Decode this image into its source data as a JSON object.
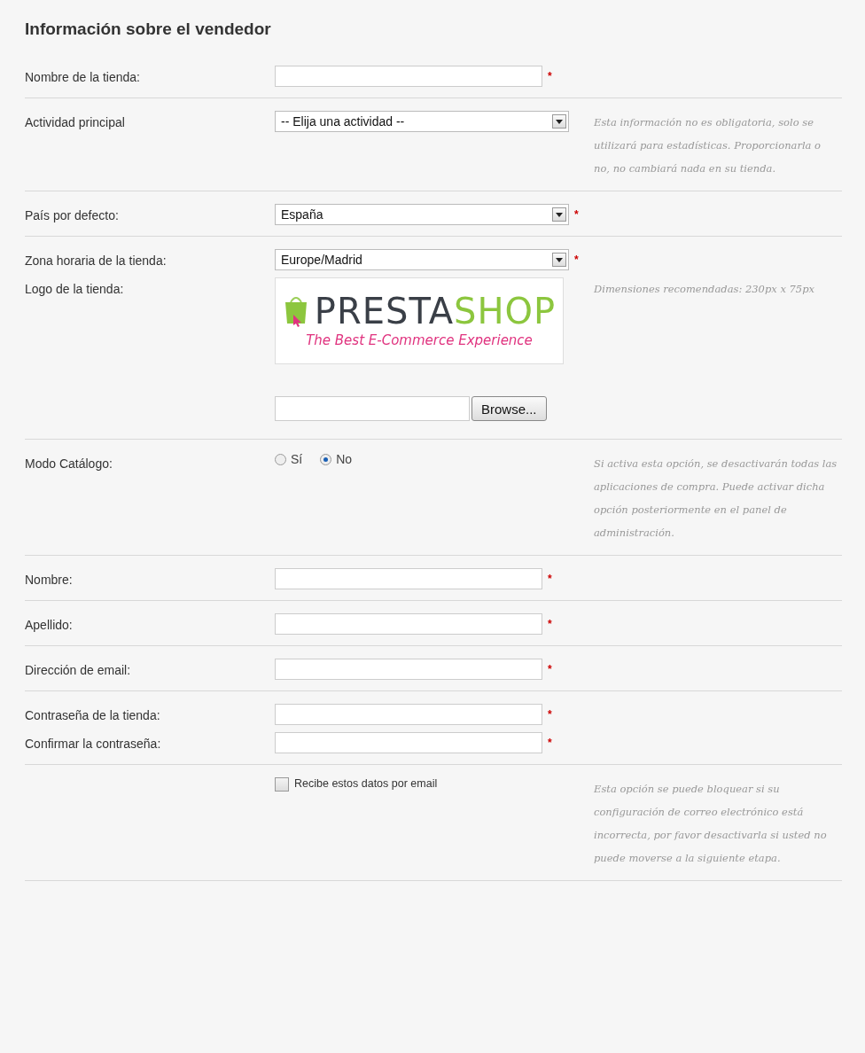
{
  "title": "Información sobre el vendedor",
  "sections": [
    {
      "rows": [
        {
          "kind": "text",
          "label": "Nombre de la tienda:",
          "required_mark": "*"
        }
      ]
    },
    {
      "rows": [
        {
          "kind": "select",
          "label": "Actividad principal",
          "value": "-- Elija una actividad --",
          "hint": "Esta información no es obligatoria, solo se utilizará para estadísticas. Proporcionarla o no, no cambiará nada en su tienda."
        }
      ]
    },
    {
      "rows": [
        {
          "kind": "select",
          "label": "País por defecto:",
          "value": "España",
          "required_mark": "*"
        }
      ]
    },
    {
      "rows": [
        {
          "kind": "select",
          "label": "Zona horaria de la tienda:",
          "value": "Europe/Madrid",
          "required_mark": "*"
        },
        {
          "kind": "logo",
          "label": "Logo de la tienda:",
          "logo": {
            "word_left": "PRESTA",
            "word_right": "SHOP",
            "tagline": "The Best E-Commerce Experience"
          },
          "button": "Browse...",
          "hint": "Dimensiones recomendadas: 230px x 75px"
        }
      ]
    },
    {
      "rows": [
        {
          "kind": "radio",
          "label": "Modo Catálogo:",
          "options": [
            {
              "label": "Sí",
              "selected": false
            },
            {
              "label": "No",
              "selected": true
            }
          ],
          "hint": "Si activa esta opción, se desactivarán todas las aplicaciones de compra. Puede activar dicha opción posteriormente en el panel de administración."
        }
      ]
    },
    {
      "rows": [
        {
          "kind": "text",
          "label": "Nombre:",
          "required_mark": "*"
        }
      ]
    },
    {
      "rows": [
        {
          "kind": "text",
          "label": "Apellido:",
          "required_mark": "*"
        }
      ]
    },
    {
      "rows": [
        {
          "kind": "text",
          "label": "Dirección de email:",
          "required_mark": "*"
        }
      ]
    },
    {
      "rows": [
        {
          "kind": "text",
          "label": "Contraseña de la tienda:",
          "required_mark": "*"
        },
        {
          "kind": "text",
          "label": "Confirmar la contraseña:",
          "required_mark": "*"
        }
      ]
    },
    {
      "rows": [
        {
          "kind": "checkbox",
          "checkbox_label": "Recibe estos datos por email",
          "checked": false,
          "hint": "Esta opción se puede bloquear si su configuración de correo electrónico está incorrecta, por favor desactivarla si usted no puede moverse a la siguiente etapa."
        }
      ]
    }
  ]
}
